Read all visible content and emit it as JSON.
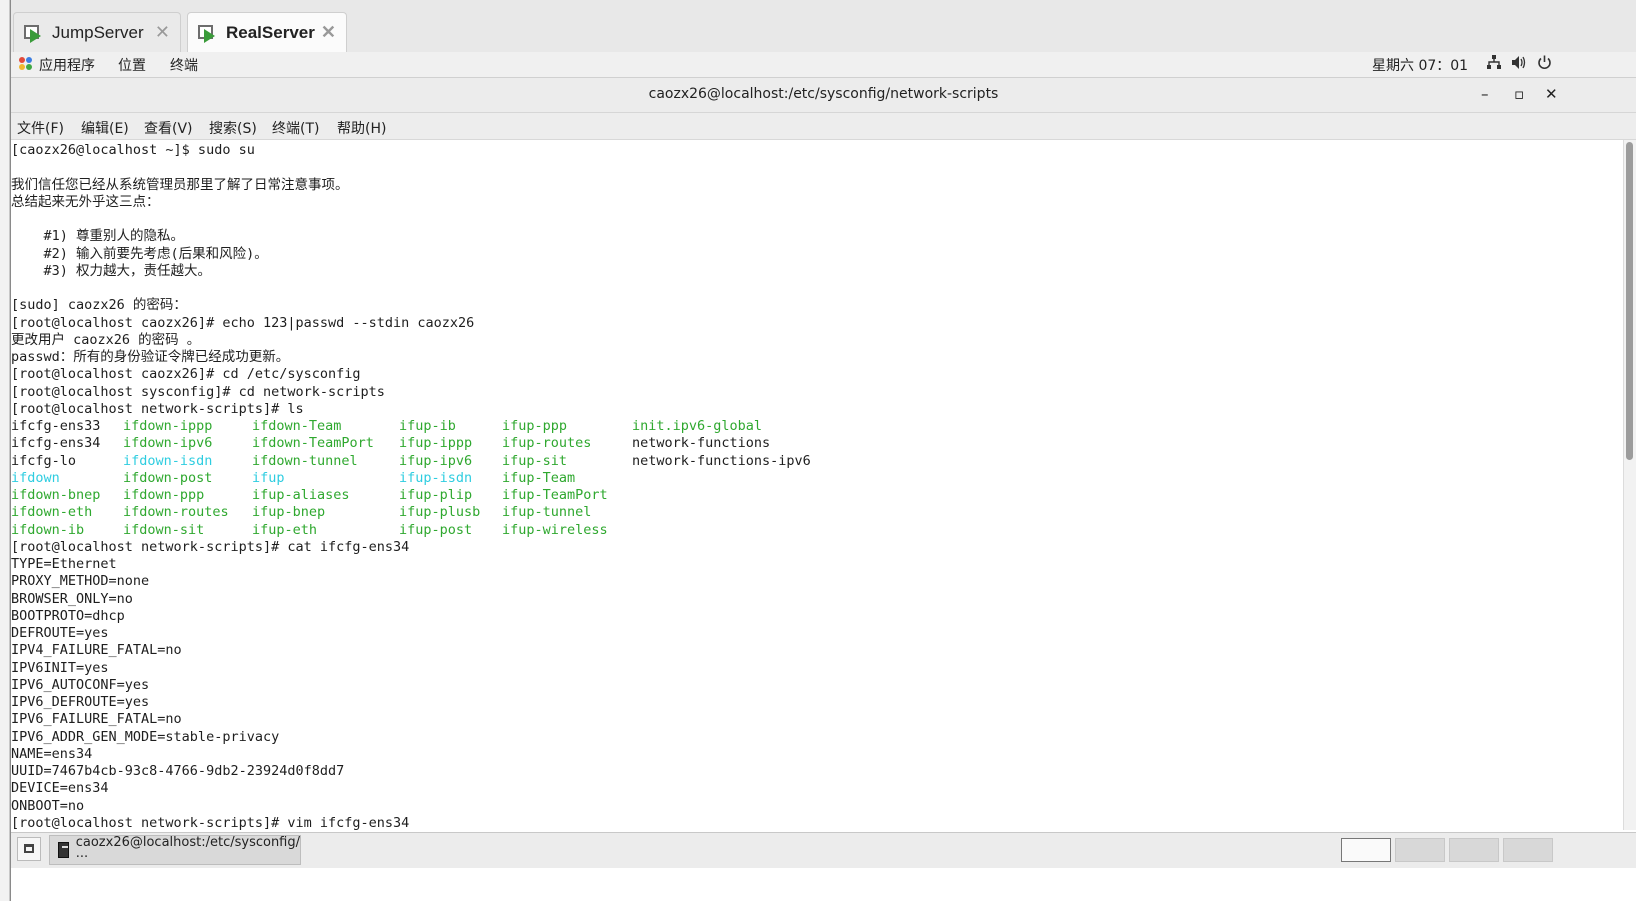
{
  "vm_tabs": [
    {
      "label": "JumpServer",
      "active": false
    },
    {
      "label": "RealServer",
      "active": true
    }
  ],
  "gnome_panel": {
    "apps": "应用程序",
    "places": "位置",
    "terminal": "终端",
    "clock": "星期六 07：01",
    "icons": [
      "network-icon",
      "volume-icon",
      "power-icon"
    ]
  },
  "window": {
    "title": "caozx26@localhost:/etc/sysconfig/network-scripts",
    "minimize": "–",
    "maximize": "▫",
    "close": "✕"
  },
  "menubar": [
    "文件(F)",
    "编辑(E)",
    "查看(V)",
    "搜索(S)",
    "终端(T)",
    "帮助(H)"
  ],
  "colors": {
    "executable": "#2fa82f",
    "symlink": "#2ecde0",
    "text": "#1e1e1e"
  },
  "terminal": {
    "pre_lines": [
      "[caozx26@localhost ~]$ sudo su",
      "",
      "我们信任您已经从系统管理员那里了解了日常注意事项。",
      "总结起来无外乎这三点：",
      "",
      "    #1) 尊重别人的隐私。",
      "    #2) 输入前要先考虑(后果和风险)。",
      "    #3) 权力越大，责任越大。",
      "",
      "[sudo] caozx26 的密码：",
      "[root@localhost caozx26]# echo 123|passwd --stdin caozx26",
      "更改用户 caozx26 的密码 。",
      "passwd：所有的身份验证令牌已经成功更新。",
      "[root@localhost caozx26]# cd /etc/sysconfig",
      "[root@localhost sysconfig]# cd network-scripts",
      "[root@localhost network-scripts]# ls"
    ],
    "ls_rows": [
      [
        {
          "t": "ifcfg-ens33",
          "c": "plain"
        },
        {
          "t": "ifdown-ippp",
          "c": "exec"
        },
        {
          "t": "ifdown-Team",
          "c": "exec"
        },
        {
          "t": "ifup-ib",
          "c": "exec"
        },
        {
          "t": "ifup-ppp",
          "c": "exec"
        },
        {
          "t": "init.ipv6-global",
          "c": "exec"
        }
      ],
      [
        {
          "t": "ifcfg-ens34",
          "c": "plain"
        },
        {
          "t": "ifdown-ipv6",
          "c": "exec"
        },
        {
          "t": "ifdown-TeamPort",
          "c": "exec"
        },
        {
          "t": "ifup-ippp",
          "c": "exec"
        },
        {
          "t": "ifup-routes",
          "c": "exec"
        },
        {
          "t": "network-functions",
          "c": "plain"
        }
      ],
      [
        {
          "t": "ifcfg-lo",
          "c": "plain"
        },
        {
          "t": "ifdown-isdn",
          "c": "sym"
        },
        {
          "t": "ifdown-tunnel",
          "c": "exec"
        },
        {
          "t": "ifup-ipv6",
          "c": "exec"
        },
        {
          "t": "ifup-sit",
          "c": "exec"
        },
        {
          "t": "network-functions-ipv6",
          "c": "plain"
        }
      ],
      [
        {
          "t": "ifdown",
          "c": "sym"
        },
        {
          "t": "ifdown-post",
          "c": "exec"
        },
        {
          "t": "ifup",
          "c": "sym"
        },
        {
          "t": "ifup-isdn",
          "c": "sym"
        },
        {
          "t": "ifup-Team",
          "c": "exec"
        },
        {
          "t": "",
          "c": "plain"
        }
      ],
      [
        {
          "t": "ifdown-bnep",
          "c": "exec"
        },
        {
          "t": "ifdown-ppp",
          "c": "exec"
        },
        {
          "t": "ifup-aliases",
          "c": "exec"
        },
        {
          "t": "ifup-plip",
          "c": "exec"
        },
        {
          "t": "ifup-TeamPort",
          "c": "exec"
        },
        {
          "t": "",
          "c": "plain"
        }
      ],
      [
        {
          "t": "ifdown-eth",
          "c": "exec"
        },
        {
          "t": "ifdown-routes",
          "c": "exec"
        },
        {
          "t": "ifup-bnep",
          "c": "exec"
        },
        {
          "t": "ifup-plusb",
          "c": "exec"
        },
        {
          "t": "ifup-tunnel",
          "c": "exec"
        },
        {
          "t": "",
          "c": "plain"
        }
      ],
      [
        {
          "t": "ifdown-ib",
          "c": "exec"
        },
        {
          "t": "ifdown-sit",
          "c": "exec"
        },
        {
          "t": "ifup-eth",
          "c": "exec"
        },
        {
          "t": "ifup-post",
          "c": "exec"
        },
        {
          "t": "ifup-wireless",
          "c": "exec"
        },
        {
          "t": "",
          "c": "plain"
        }
      ]
    ],
    "post_lines": [
      "[root@localhost network-scripts]# cat ifcfg-ens34",
      "TYPE=Ethernet",
      "PROXY_METHOD=none",
      "BROWSER_ONLY=no",
      "BOOTPROTO=dhcp",
      "DEFROUTE=yes",
      "IPV4_FAILURE_FATAL=no",
      "IPV6INIT=yes",
      "IPV6_AUTOCONF=yes",
      "IPV6_DEFROUTE=yes",
      "IPV6_FAILURE_FATAL=no",
      "IPV6_ADDR_GEN_MODE=stable-privacy",
      "NAME=ens34",
      "UUID=7467b4cb-93c8-4766-9db2-23924d0f8dd7",
      "DEVICE=ens34",
      "ONBOOT=no",
      "[root@localhost network-scripts]# vim ifcfg-ens34"
    ]
  },
  "taskbar": {
    "window_button": "caozx26@localhost:/etc/sysconfig/···",
    "workspaces": 4,
    "active_workspace": 1
  }
}
